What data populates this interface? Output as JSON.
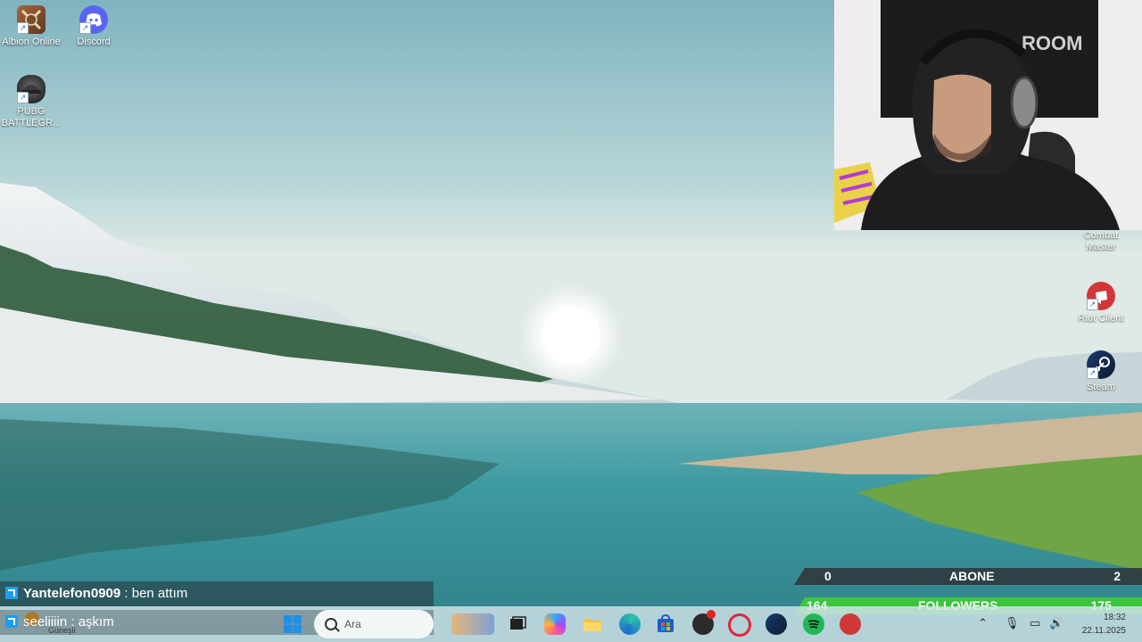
{
  "desktop": {
    "icons_left": [
      {
        "name": "albion-online-icon",
        "label": "Albion Online"
      },
      {
        "name": "discord-icon",
        "label": "Discord"
      },
      {
        "name": "pubg-icon",
        "label": "PUBG BATTLEGR..."
      }
    ],
    "icons_right": [
      {
        "name": "combat-master-icon",
        "label": "Combat Master"
      },
      {
        "name": "riot-client-icon",
        "label": "Riot Client"
      },
      {
        "name": "steam-icon",
        "label": "Steam"
      }
    ]
  },
  "chat": {
    "messages": [
      {
        "user": "Yantelefon0909",
        "text": " : ben attım"
      },
      {
        "user": "seeliiiin",
        "text": " : aşkım"
      }
    ]
  },
  "stats": {
    "abone": {
      "left": "0",
      "label": "ABONE",
      "right": "2"
    },
    "followers": {
      "left": "164",
      "label": "FOLLOWERS",
      "right": "175"
    }
  },
  "taskbar": {
    "weather_sub": "Güneşli",
    "search_placeholder": "Ara",
    "apps": [
      "widgets-icon",
      "task-view-icon",
      "copilot-icon",
      "file-explorer-icon",
      "edge-icon",
      "store-icon",
      "obs-icon",
      "opera-gx-icon",
      "steam-taskbar-icon",
      "spotify-icon",
      "riot-taskbar-icon"
    ],
    "clock_time": "18:32",
    "clock_date": "22.11.2025"
  },
  "webcam": {
    "banner_text": "ROOM"
  }
}
